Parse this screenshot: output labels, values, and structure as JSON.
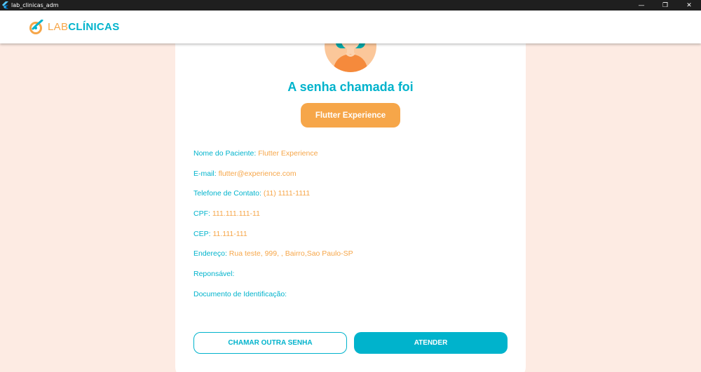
{
  "window": {
    "title": "lab_clinicas_adm",
    "controls": {
      "minimize": "—",
      "restore": "❐",
      "close": "✕"
    }
  },
  "brand": {
    "part1": "LAB",
    "part2": "CLÍNICAS",
    "colors": {
      "orange": "#f6a649",
      "teal": "#00b3cc"
    }
  },
  "main": {
    "heading": "A senha chamada foi",
    "called_name": "Flutter Experience",
    "fields": [
      {
        "label": "Nome do Paciente: ",
        "value": "Flutter Experience"
      },
      {
        "label": "E-mail: ",
        "value": "flutter@experience.com"
      },
      {
        "label": "Telefone de Contato: ",
        "value": "(11) 1111-1111"
      },
      {
        "label": "CPF: ",
        "value": "111.111.111-11"
      },
      {
        "label": "CEP: ",
        "value": "11.111-111"
      },
      {
        "label": "Endereço: ",
        "value": "Rua teste, 999, , Bairro,Sao Paulo-SP"
      },
      {
        "label": "Reponsável: ",
        "value": ""
      },
      {
        "label": "Documento de Identificação: ",
        "value": ""
      }
    ]
  },
  "actions": {
    "call_another": "CHAMAR OUTRA SENHA",
    "attend": "ATENDER"
  },
  "icons": {
    "app": "flutter-icon",
    "logo": "labclinicas-logo-icon",
    "avatar": "patient-avatar"
  }
}
